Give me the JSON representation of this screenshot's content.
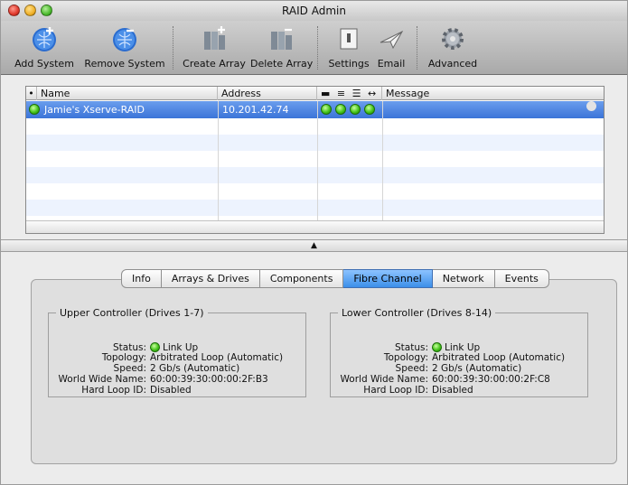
{
  "window": {
    "title": "RAID Admin"
  },
  "toolbar": {
    "add_system": "Add System",
    "remove_system": "Remove System",
    "create_array": "Create Array",
    "delete_array": "Delete Array",
    "settings": "Settings",
    "email": "Email",
    "advanced": "Advanced"
  },
  "list": {
    "columns": {
      "name": "Name",
      "address": "Address",
      "message": "Message"
    },
    "rows": [
      {
        "name": "Jamie's Xserve-RAID",
        "address": "10.201.42.74",
        "status_leds": 4
      }
    ]
  },
  "tabs": [
    "Info",
    "Arrays & Drives",
    "Components",
    "Fibre Channel",
    "Network",
    "Events"
  ],
  "active_tab": "Fibre Channel",
  "fibre": {
    "upper": {
      "title": "Upper Controller (Drives 1-7)",
      "status_label": "Status:",
      "status": "Link Up",
      "topology_label": "Topology:",
      "topology": "Arbitrated Loop (Automatic)",
      "speed_label": "Speed:",
      "speed": "2 Gb/s (Automatic)",
      "wwn_label": "World Wide Name:",
      "wwn": "60:00:39:30:00:00:2F:B3",
      "hlid_label": "Hard Loop ID:",
      "hlid": "Disabled"
    },
    "lower": {
      "title": "Lower Controller (Drives 8-14)",
      "status_label": "Status:",
      "status": "Link Up",
      "topology_label": "Topology:",
      "topology": "Arbitrated Loop (Automatic)",
      "speed_label": "Speed:",
      "speed": "2 Gb/s (Automatic)",
      "wwn_label": "World Wide Name:",
      "wwn": "60:00:39:30:00:00:2F:C8",
      "hlid_label": "Hard Loop ID:",
      "hlid": "Disabled"
    }
  },
  "colors": {
    "selection": "#3b74d8",
    "led": "#46c41c",
    "active_tab": "#3c8fe9"
  }
}
